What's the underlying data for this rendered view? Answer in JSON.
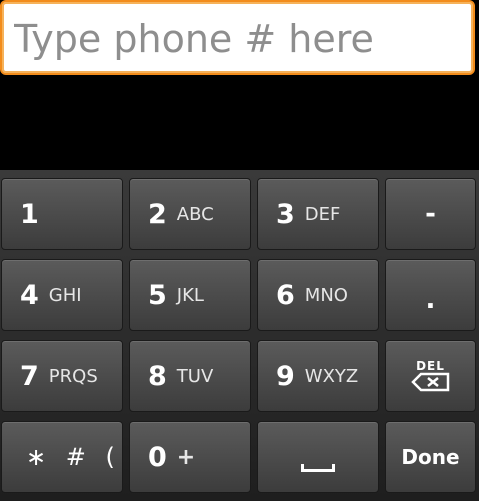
{
  "input": {
    "placeholder": "Type phone # here",
    "value": ""
  },
  "keys": {
    "k1": {
      "num": "1",
      "letters": ""
    },
    "k2": {
      "num": "2",
      "letters": "ABC"
    },
    "k3": {
      "num": "3",
      "letters": "DEF"
    },
    "k4": {
      "num": "4",
      "letters": "GHI"
    },
    "k5": {
      "num": "5",
      "letters": "JKL"
    },
    "k6": {
      "num": "6",
      "letters": "MNO"
    },
    "k7": {
      "num": "7",
      "letters": "PRQS"
    },
    "k8": {
      "num": "8",
      "letters": "TUV"
    },
    "k9": {
      "num": "9",
      "letters": "WXYZ"
    },
    "k0": {
      "num": "0",
      "letters": "+"
    },
    "dash": "-",
    "dot": ".",
    "del": "DEL",
    "special": "∗ # (",
    "done": "Done"
  },
  "colors": {
    "focus_border": "#f28c1c",
    "key_bg": "#4a4a4a"
  }
}
